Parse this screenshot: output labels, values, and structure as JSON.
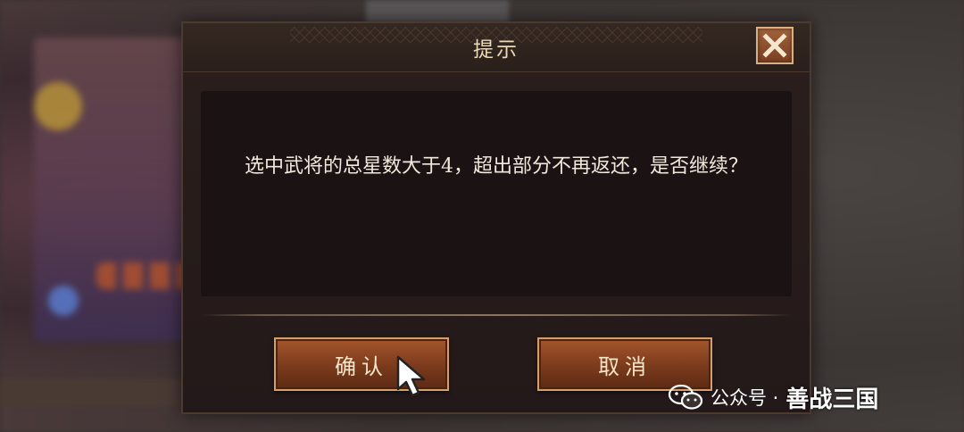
{
  "dialog": {
    "title": "提示",
    "message": "选中武将的总星数大于4，超出部分不再返还，是否继续？",
    "confirm_label": "确认",
    "cancel_label": "取消"
  },
  "watermark": {
    "prefix": "公众号 ·",
    "brand": "善战三国",
    "icon": "wechat-icon"
  },
  "colors": {
    "dialog_bg": "#24191a",
    "button": "#7a3a1c",
    "button_border": "#d69f6a",
    "title_text": "#e9d9b8"
  }
}
